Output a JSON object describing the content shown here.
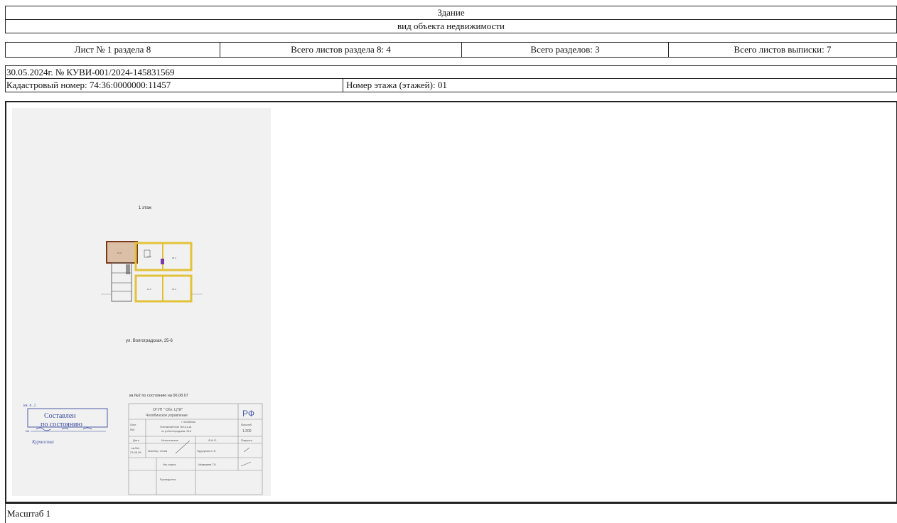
{
  "header": {
    "building": "Здание",
    "object_type": "вид объекта недвижимости"
  },
  "sheet_info": {
    "sheet_no": "Лист № 1 раздела 8",
    "sheets_in_section": "Всего листов раздела 8: 4",
    "total_sections": "Всего разделов: 3",
    "total_sheets": "Всего листов выписки: 7"
  },
  "record": {
    "date_number": "30.05.2024г. № КУВИ-001/2024-145831569",
    "cadastral_number": "Кадастровый номер: 74:36:0000000:11457",
    "floor_number": "Номер этажа (этажей): 01"
  },
  "plan": {
    "floor_label": "1 этаж",
    "street": "ул. Волгоградская, 25-6",
    "apartment_state": "кв.№2 по состоянию на 06.08.07",
    "stamp": {
      "title": "Составлен",
      "subtitle": "по состоянию",
      "date_prefix": "на",
      "handwritten_note": "кв. п. 2",
      "signature": "Курносова"
    },
    "title_block": {
      "org": "ОГУП \" Обл. ЦТИ\"",
      "branch": "Челябинское управление",
      "rf": "РФ",
      "city": "г. Челябинск",
      "sheet_label": "Лист",
      "sheet_value": "№2",
      "desc_line1": "Поэтажный план Лит.А,а,а1",
      "desc_line2": "по ул.Волгоградская, 25-6",
      "scale_label": "Масштаб",
      "scale_value": "1:200",
      "date_label": "Дата",
      "executor_label": "Исполнитель",
      "fio_label": "Ф.И.О.",
      "signature_label": "Подпись",
      "row1_date1": "кв.№1",
      "row1_date2": "23.08.08",
      "row1_role": "Инженер, техник",
      "row1_name": "Нурусулина С.Ф.",
      "row2_role": "Нач.отдела",
      "row2_name": "Медведева Т.И.",
      "row3_role": "Руководитель"
    },
    "scale_footer": "Масштаб 1"
  }
}
